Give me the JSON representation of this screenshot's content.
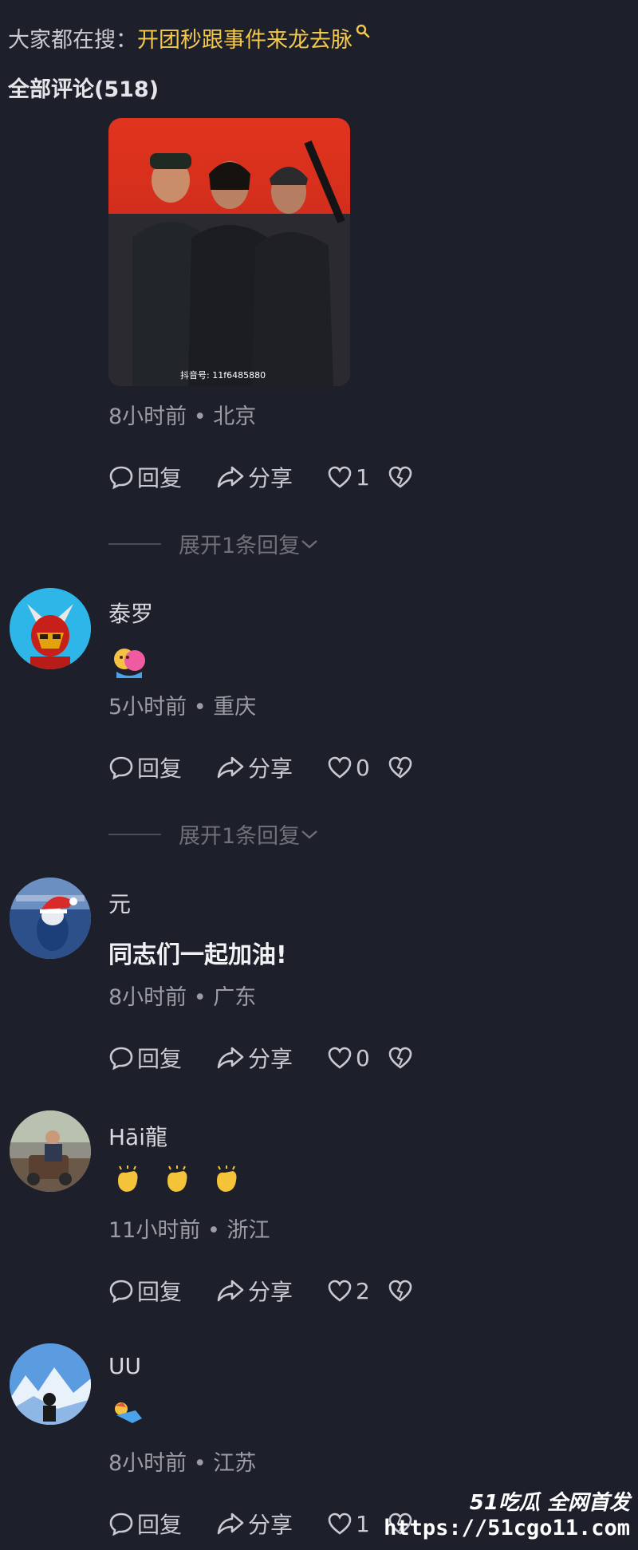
{
  "search": {
    "prefix": "大家都在搜：",
    "term": "开团秒跟事件来龙去脉"
  },
  "comments_header": "全部评论(518)",
  "first_comment": {
    "meta": "8小时前 • 北京",
    "likes": "1",
    "expand": "展开1条回复"
  },
  "comments": [
    {
      "username": "泰罗",
      "meta": "5小时前 • 重庆",
      "likes": "0",
      "expand": "展开1条回复"
    },
    {
      "username": "元",
      "text": "同志们一起加油!",
      "meta": "8小时前 • 广东",
      "likes": "0"
    },
    {
      "username": "Hāi龍",
      "meta": "11小时前 • 浙江",
      "likes": "2"
    },
    {
      "username": "UU",
      "meta": "8小时前 • 江苏",
      "likes": "1"
    }
  ],
  "actions": {
    "reply": "回复",
    "share": "分享"
  },
  "image_caption": "抖音号: 11f6485880",
  "watermark": {
    "brand": "51吃瓜 全网首发",
    "url": "https://51cgo11.com"
  },
  "colors": {
    "background": "#1d1f2a",
    "search_term": "#f2c94c",
    "meta": "#9b9ca6"
  }
}
